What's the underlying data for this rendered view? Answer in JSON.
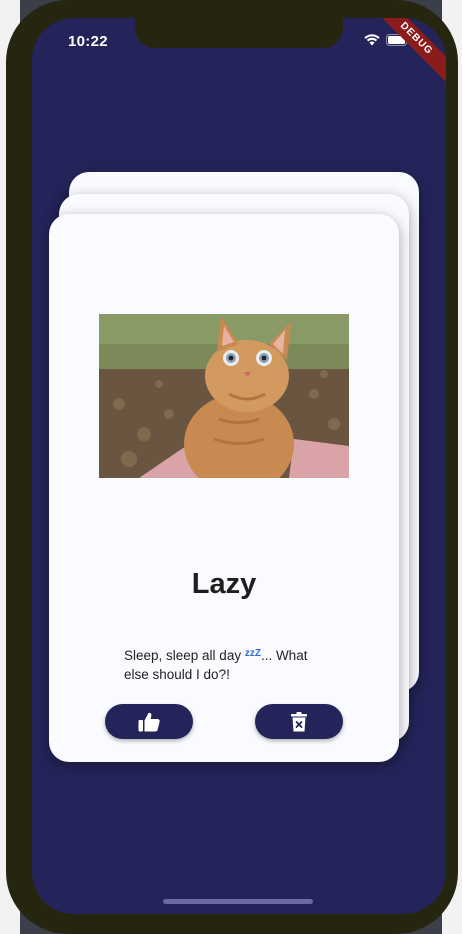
{
  "status_bar": {
    "time": "10:22",
    "debug_label": "DEBUG"
  },
  "card": {
    "title": "Lazy",
    "description_before": "Sleep, sleep all day ",
    "description_zz": "zzZ",
    "description_after": "... What else should I do?!",
    "image_icon": "cat-photo"
  },
  "actions": {
    "like_icon": "thumbs-up-icon",
    "delete_icon": "trash-icon"
  },
  "colors": {
    "screen_bg": "#24245a",
    "card_bg": "#fafbff",
    "button_bg": "#24245a"
  }
}
